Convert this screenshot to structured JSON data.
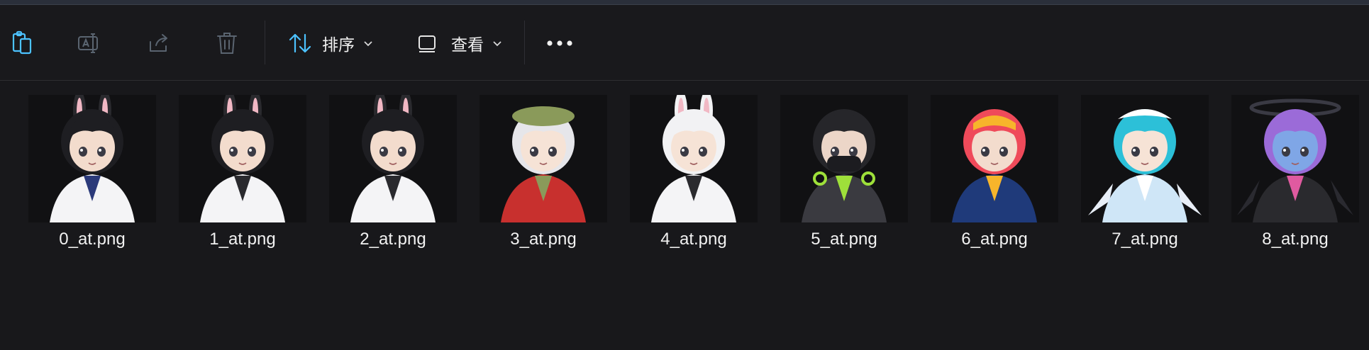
{
  "toolbar": {
    "icons": [
      {
        "name": "paste-icon"
      },
      {
        "name": "rename-icon"
      },
      {
        "name": "share-icon"
      },
      {
        "name": "delete-icon"
      }
    ],
    "sort_label": "排序",
    "view_label": "查看",
    "more_label": "•••",
    "accent_color": "#4cc2ff"
  },
  "files": [
    {
      "name": "0_at.png",
      "hair": "#1e1e22",
      "skin": "#f3dccd",
      "outfit": "#f4f4f6",
      "ears": "bunny",
      "accent": "#2b3a7a"
    },
    {
      "name": "1_at.png",
      "hair": "#1e1e22",
      "skin": "#f3dccd",
      "outfit": "#f4f4f6",
      "ears": "bunny",
      "accent": "#2a2a2e"
    },
    {
      "name": "2_at.png",
      "hair": "#1e1e22",
      "skin": "#f3dccd",
      "outfit": "#f4f4f6",
      "ears": "bunny",
      "accent": "#2a2a2e"
    },
    {
      "name": "3_at.png",
      "hair": "#e6e6ea",
      "skin": "#f6e3d6",
      "outfit": "#c8302e",
      "ears": "beret",
      "accent": "#8a9a5a"
    },
    {
      "name": "4_at.png",
      "hair": "#f2f2f4",
      "skin": "#f6e3d6",
      "outfit": "#f4f4f6",
      "ears": "bunny",
      "accent": "#2a2a2e"
    },
    {
      "name": "5_at.png",
      "hair": "#26262a",
      "skin": "#ecd6c8",
      "outfit": "#3a3a40",
      "ears": "none",
      "accent": "#9ee03a"
    },
    {
      "name": "6_at.png",
      "hair": "#ef4a5a",
      "skin": "#f3dccd",
      "outfit": "#1f3a7a",
      "ears": "none",
      "accent": "#f7b52b"
    },
    {
      "name": "7_at.png",
      "hair": "#2cc0d8",
      "skin": "#f6e3d6",
      "outfit": "#cfe6f7",
      "ears": "maid",
      "accent": "#ffffff"
    },
    {
      "name": "8_at.png",
      "hair": "#9b6bd8",
      "skin": "#7fa6e6",
      "outfit": "#2a2a2e",
      "ears": "halo",
      "accent": "#e05aa0"
    }
  ]
}
